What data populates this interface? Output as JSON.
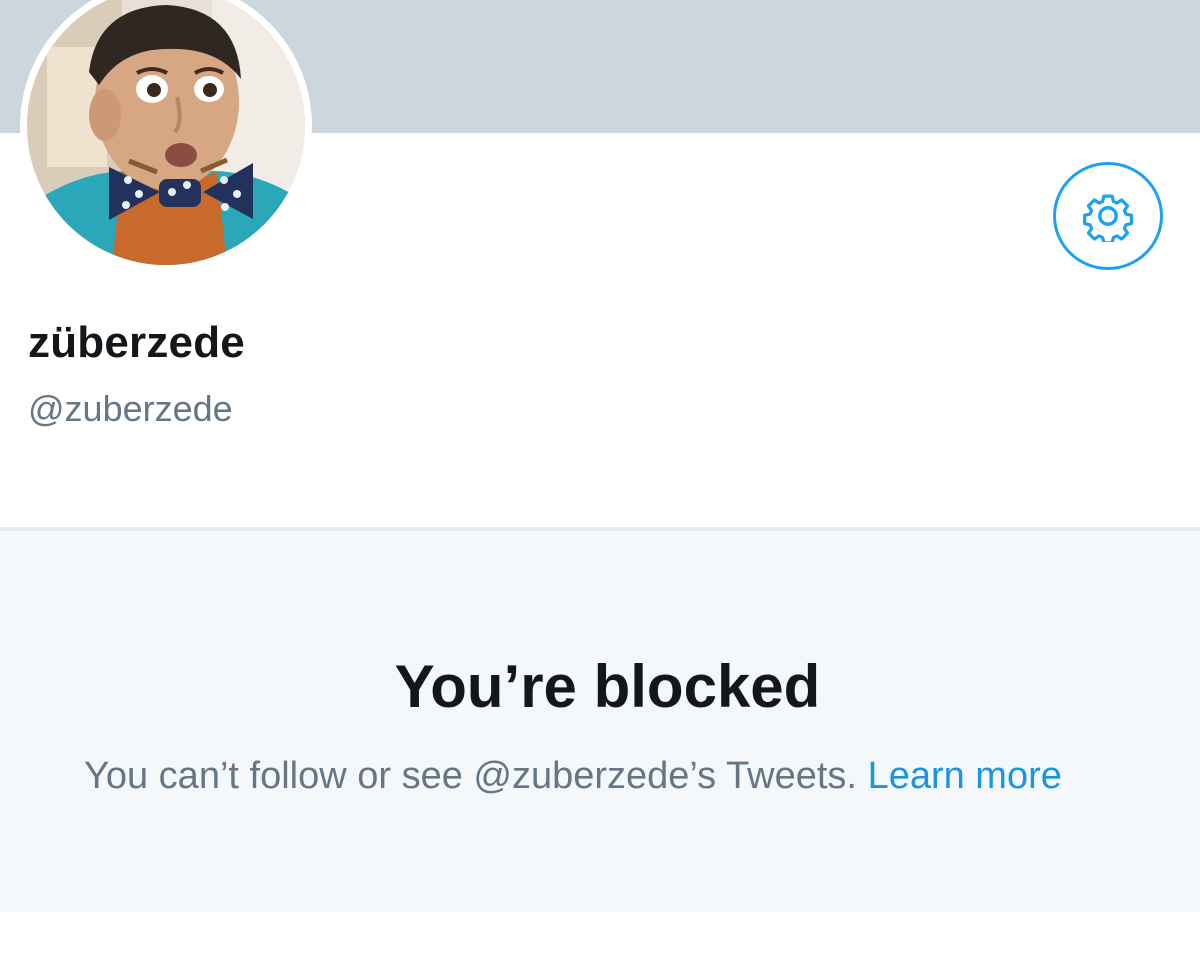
{
  "profile": {
    "display_name": "züberzede",
    "handle": "@zuberzede",
    "banner_color": "#ccd6dd",
    "avatar": "avatar-photo",
    "settings_icon": "gear-icon"
  },
  "blocked": {
    "title": "You’re blocked",
    "message": "You can’t follow or see @zuberzede’s Tweets.",
    "link_label": "Learn more"
  },
  "colors": {
    "accent": "#1da1f2",
    "link": "#1b95e0",
    "text_primary": "#14171a",
    "text_secondary": "#657786",
    "panel_background": "#f5f8fa"
  }
}
